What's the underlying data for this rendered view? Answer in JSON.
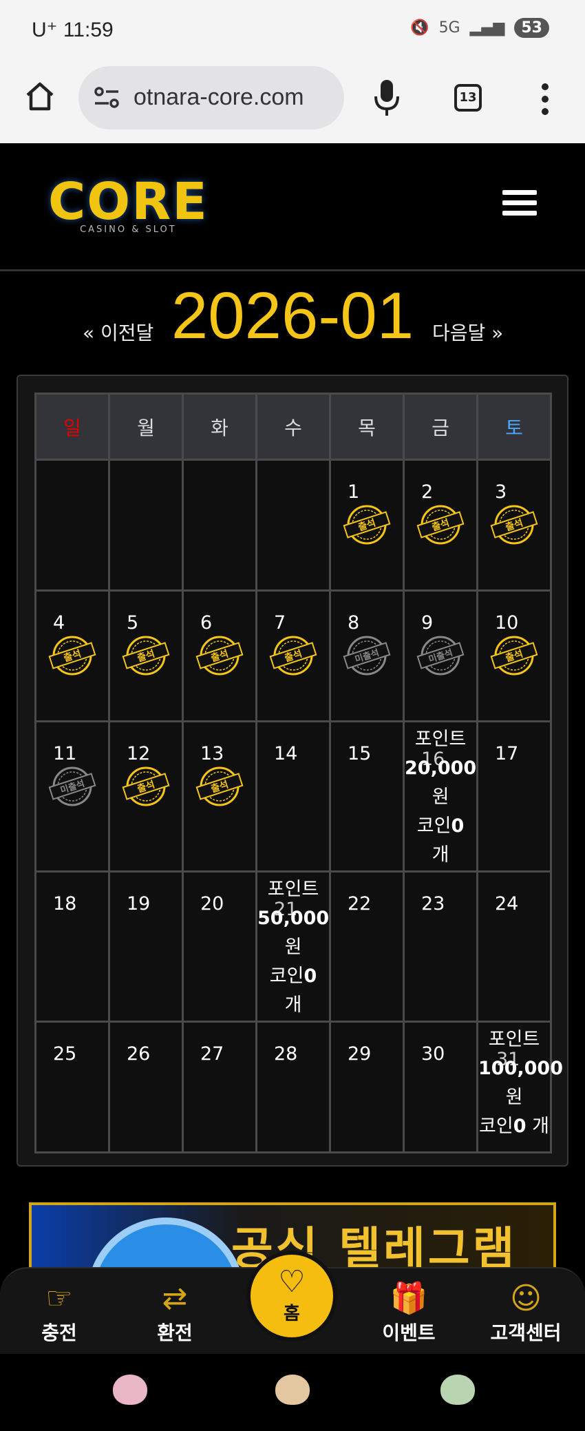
{
  "status_bar": {
    "carrier": "U⁺ 11:59",
    "network": "5G",
    "battery": "53"
  },
  "browser": {
    "url": "otnara-core.com",
    "tab_count": "13"
  },
  "header": {
    "logo_text": "CORE",
    "logo_sub": "CASINO & SLOT"
  },
  "calendar": {
    "month": "2026-01",
    "prev_label": "« 이전달",
    "next_label": "다음달 »",
    "weekdays": [
      "일",
      "월",
      "화",
      "수",
      "목",
      "금",
      "토"
    ],
    "stamp_attended": "출석",
    "stamp_missed": "미출석",
    "days": {
      "1": "1",
      "2": "2",
      "3": "3",
      "4": "4",
      "5": "5",
      "6": "6",
      "7": "7",
      "8": "8",
      "9": "9",
      "10": "10",
      "11": "11",
      "12": "12",
      "13": "13",
      "14": "14",
      "15": "15",
      "16": "16",
      "17": "17",
      "18": "18",
      "19": "19",
      "20": "20",
      "21": "21",
      "22": "22",
      "23": "23",
      "24": "24",
      "25": "25",
      "26": "26",
      "27": "27",
      "28": "28",
      "29": "29",
      "30": "30",
      "31": "31"
    },
    "prize_16": {
      "label": "포인트",
      "amount": "20,000",
      "unit": "원",
      "coin": "코인",
      "coin_count": "0",
      "coin_unit": "개"
    },
    "prize_21": {
      "label": "포인트",
      "amount": "50,000",
      "unit": "원",
      "coin": "코인",
      "coin_count": "0",
      "coin_unit": "개"
    },
    "prize_31": {
      "label": "포인트",
      "amount": "100,000",
      "unit": "원",
      "coin": "코인",
      "coin_count": "0",
      "coin_unit": "개"
    }
  },
  "banner": {
    "text": "공식 텔레그램"
  },
  "bottom_nav": {
    "charge": "충전",
    "exchange": "환전",
    "home": "홈",
    "event": "이벤트",
    "support": "고객센터"
  },
  "colors": {
    "accent": "#f5c518",
    "sunday": "#e30000",
    "saturday": "#4aa8ff",
    "missed_stamp": "#888888"
  }
}
